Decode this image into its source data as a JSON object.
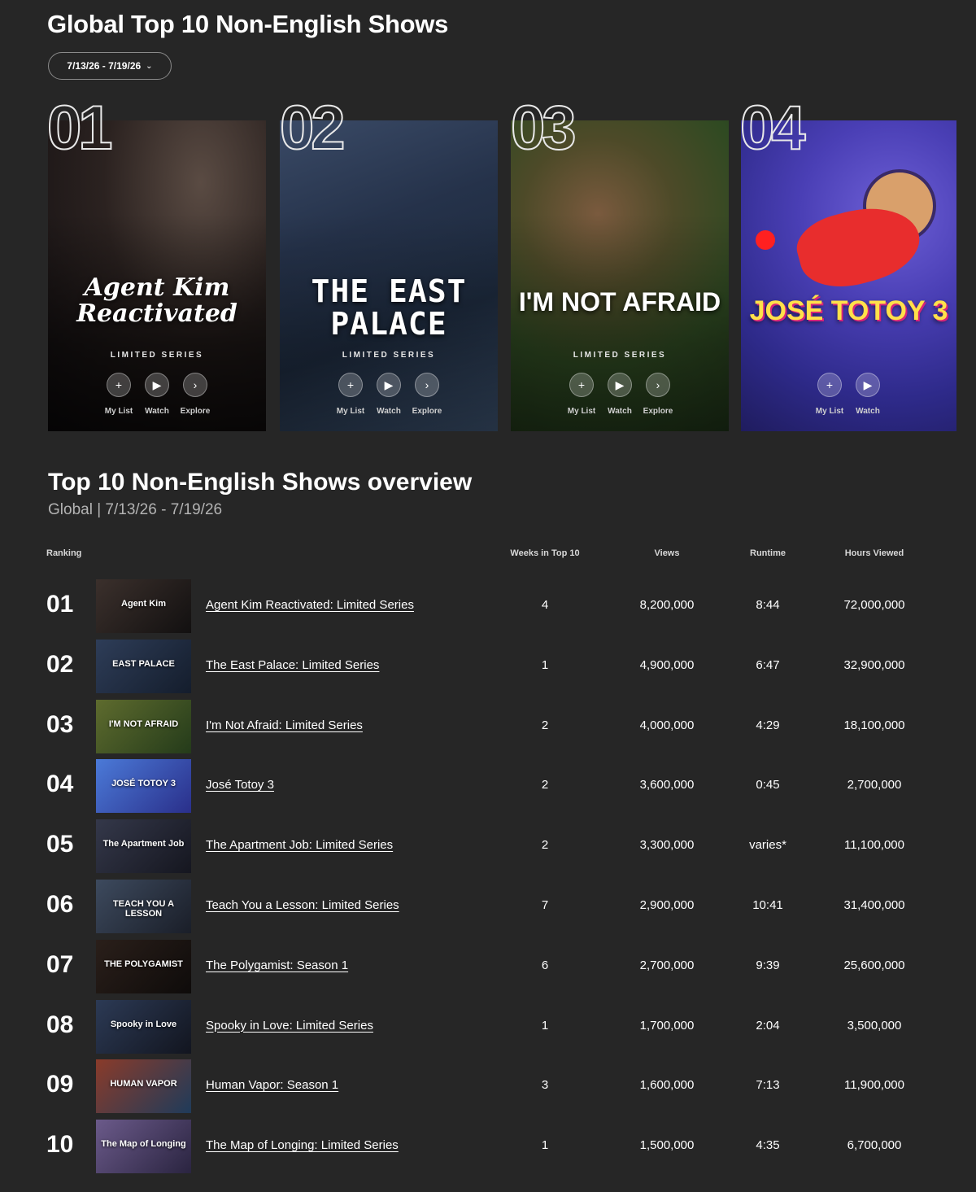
{
  "header": {
    "title": "Global Top 10 Non-English Shows",
    "date_range": "7/13/26 - 7/19/26"
  },
  "cards": [
    {
      "rank": "01",
      "logo_text": "Agent Kim Reactivated",
      "tag": "LIMITED SERIES",
      "actions": [
        "My List",
        "Watch",
        "Explore"
      ]
    },
    {
      "rank": "02",
      "logo_text": "THE EAST PALACE",
      "tag": "LIMITED SERIES",
      "actions": [
        "My List",
        "Watch",
        "Explore"
      ]
    },
    {
      "rank": "03",
      "logo_text": "I'M NOT AFRAID",
      "tag": "LIMITED SERIES",
      "actions": [
        "My List",
        "Watch",
        "Explore"
      ]
    },
    {
      "rank": "04",
      "logo_text": "JOSÉ TOTOY 3",
      "tag": "",
      "actions": [
        "My List",
        "Watch"
      ]
    }
  ],
  "overview": {
    "title": "Top 10 Non-English Shows overview",
    "subtitle": "Global | 7/13/26 - 7/19/26",
    "columns": {
      "ranking": "Ranking",
      "weeks": "Weeks in Top 10",
      "views": "Views",
      "runtime": "Runtime",
      "hours": "Hours Viewed"
    },
    "rows": [
      {
        "rank": "01",
        "thumb": "Agent Kim",
        "title": "Agent Kim Reactivated: Limited Series",
        "weeks": "4",
        "views": "8,200,000",
        "runtime": "8:44",
        "hours": "72,000,000"
      },
      {
        "rank": "02",
        "thumb": "EAST PALACE",
        "title": "The East Palace: Limited Series",
        "weeks": "1",
        "views": "4,900,000",
        "runtime": "6:47",
        "hours": "32,900,000"
      },
      {
        "rank": "03",
        "thumb": "I'M NOT AFRAID",
        "title": "I'm Not Afraid: Limited Series",
        "weeks": "2",
        "views": "4,000,000",
        "runtime": "4:29",
        "hours": "18,100,000"
      },
      {
        "rank": "04",
        "thumb": "JOSÉ TOTOY 3",
        "title": "José Totoy 3",
        "weeks": "2",
        "views": "3,600,000",
        "runtime": "0:45",
        "hours": "2,700,000"
      },
      {
        "rank": "05",
        "thumb": "The Apartment Job",
        "title": "The Apartment Job: Limited Series",
        "weeks": "2",
        "views": "3,300,000",
        "runtime": "varies*",
        "hours": "11,100,000"
      },
      {
        "rank": "06",
        "thumb": "TEACH YOU A LESSON",
        "title": "Teach You a Lesson: Limited Series",
        "weeks": "7",
        "views": "2,900,000",
        "runtime": "10:41",
        "hours": "31,400,000"
      },
      {
        "rank": "07",
        "thumb": "THE POLYGAMIST",
        "title": "The Polygamist: Season 1",
        "weeks": "6",
        "views": "2,700,000",
        "runtime": "9:39",
        "hours": "25,600,000"
      },
      {
        "rank": "08",
        "thumb": "Spooky in Love",
        "title": "Spooky in Love: Limited Series",
        "weeks": "1",
        "views": "1,700,000",
        "runtime": "2:04",
        "hours": "3,500,000"
      },
      {
        "rank": "09",
        "thumb": "HUMAN VAPOR",
        "title": "Human Vapor: Season 1",
        "weeks": "3",
        "views": "1,600,000",
        "runtime": "7:13",
        "hours": "11,900,000"
      },
      {
        "rank": "10",
        "thumb": "The Map of Longing",
        "title": "The Map of Longing: Limited Series",
        "weeks": "1",
        "views": "1,500,000",
        "runtime": "4:35",
        "hours": "6,700,000"
      }
    ]
  },
  "icons": {
    "my_list": "plus-icon",
    "watch": "play-icon",
    "explore": "chevron-right-icon",
    "date_dropdown": "chevron-down-icon"
  },
  "colors": {
    "background": "#262626",
    "text": "#ffffff",
    "muted": "#b3b3b3"
  }
}
